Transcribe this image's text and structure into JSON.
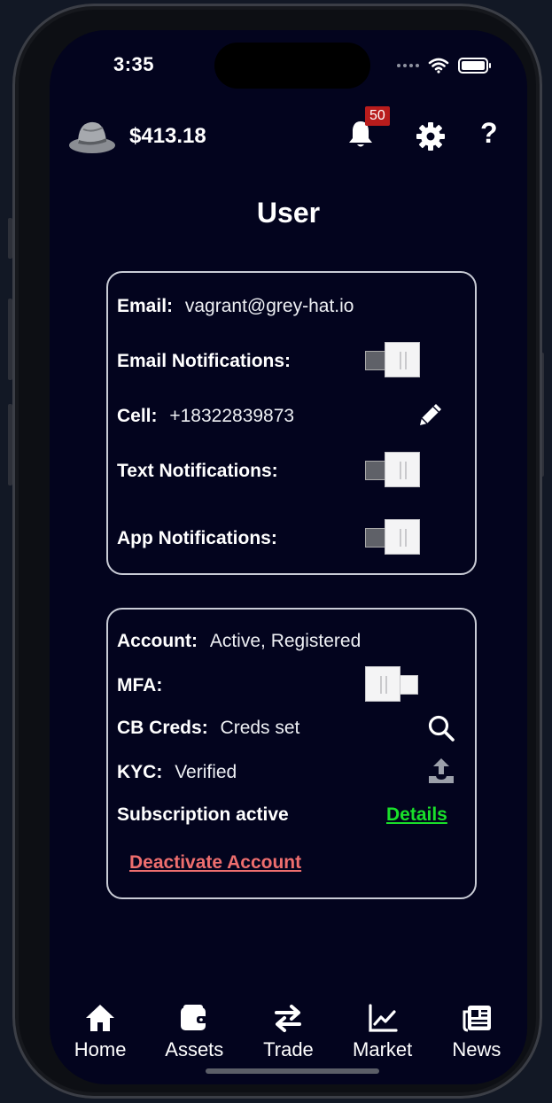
{
  "status_bar": {
    "time": "3:35"
  },
  "header": {
    "balance": "$413.18",
    "notification_count": "50",
    "help_label": "?"
  },
  "page": {
    "title": "User"
  },
  "contact_card": {
    "email_label": "Email:",
    "email_value": "vagrant@grey-hat.io",
    "email_notifications_label": "Email Notifications:",
    "email_notifications_on": false,
    "cell_label": "Cell:",
    "cell_value": "+18322839873",
    "text_notifications_label": "Text Notifications:",
    "text_notifications_on": false,
    "app_notifications_label": "App Notifications:",
    "app_notifications_on": false
  },
  "account_card": {
    "account_label": "Account:",
    "account_value": "Active, Registered",
    "mfa_label": "MFA:",
    "mfa_on": true,
    "cb_creds_label": "CB Creds:",
    "cb_creds_value": "Creds set",
    "kyc_label": "KYC:",
    "kyc_value": "Verified",
    "subscription_label": "Subscription active",
    "details_link": "Details",
    "deactivate_link": "Deactivate Account"
  },
  "tabs": [
    {
      "label": "Home",
      "icon": "home-icon"
    },
    {
      "label": "Assets",
      "icon": "wallet-icon"
    },
    {
      "label": "Trade",
      "icon": "swap-icon"
    },
    {
      "label": "Market",
      "icon": "chart-icon"
    },
    {
      "label": "News",
      "icon": "newspaper-icon"
    }
  ],
  "colors": {
    "background": "#03041e",
    "details_link": "#19e02a",
    "deactivate_link": "#ee6e6e",
    "badge": "#b81c1c"
  }
}
